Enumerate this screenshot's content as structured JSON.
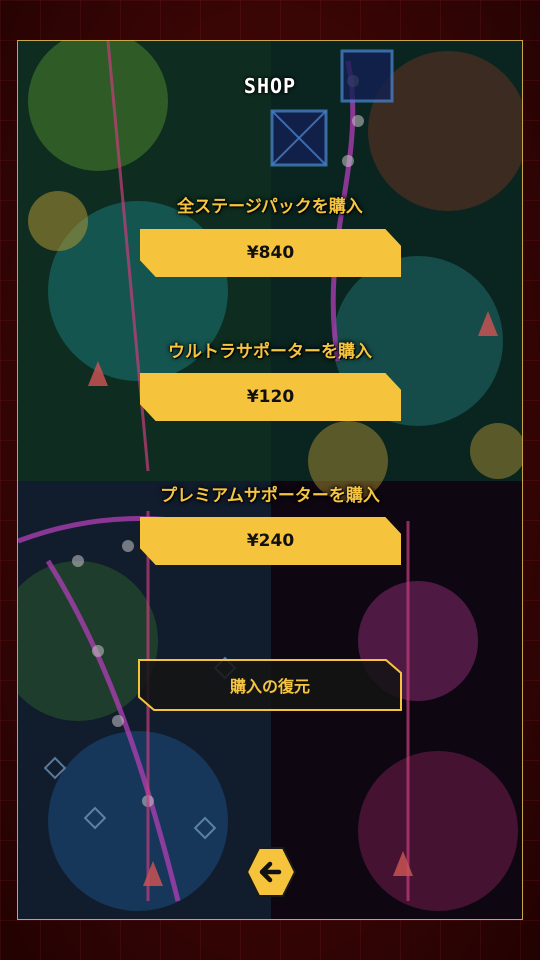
{
  "header": {
    "title": "SHOP"
  },
  "items": [
    {
      "label": "全ステージパックを購入",
      "price": "¥840"
    },
    {
      "label": "ウルトラサポーターを購入",
      "price": "¥120"
    },
    {
      "label": "プレミアムサポーターを購入",
      "price": "¥240"
    }
  ],
  "restore": {
    "label": "購入の復元"
  },
  "nav": {
    "back_icon": "arrow-left-icon"
  },
  "colors": {
    "accent": "#f6c43c",
    "frame": "#5a0a0a",
    "border": "#c9a64a"
  }
}
